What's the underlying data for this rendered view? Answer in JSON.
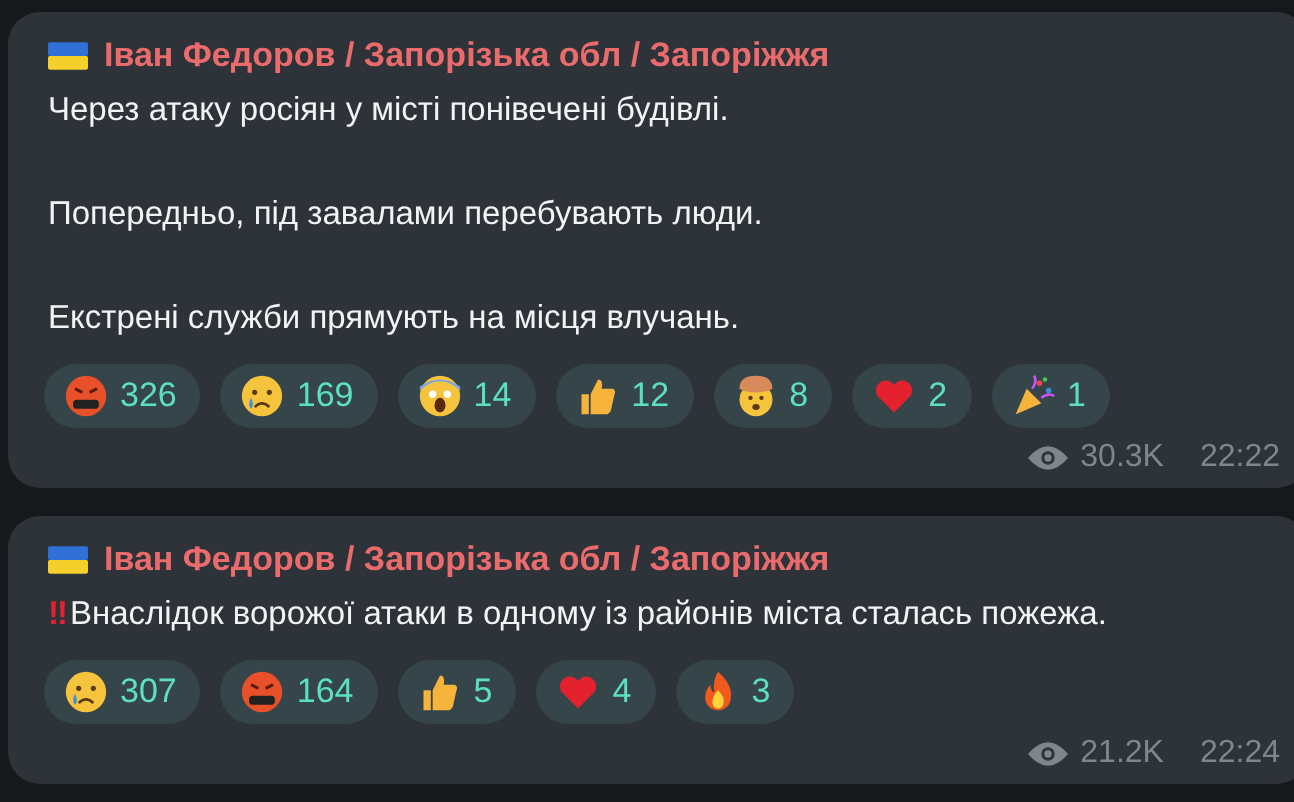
{
  "messages": [
    {
      "author": "Іван Федоров / Запорізька обл / Запоріжжя",
      "alert": false,
      "paragraphs": [
        "Через атаку росіян у місті понівечені будівлі.",
        "Попередньо, під завалами перебувають люди.",
        "Екстрені служби прямують на місця влучань."
      ],
      "reactions": [
        {
          "kind": "angry",
          "count": "326"
        },
        {
          "kind": "crying",
          "count": "169"
        },
        {
          "kind": "scream",
          "count": "14"
        },
        {
          "kind": "thumbs",
          "count": "12"
        },
        {
          "kind": "mind-blown",
          "count": "8"
        },
        {
          "kind": "heart",
          "count": "2"
        },
        {
          "kind": "party",
          "count": "1"
        }
      ],
      "views": "30.3K",
      "time": "22:22"
    },
    {
      "author": "Іван Федоров / Запорізька обл / Запоріжжя",
      "alert": true,
      "alert_mark": "‼",
      "paragraphs": [
        "Внаслідок ворожої атаки в одному із районів міста сталась пожежа."
      ],
      "reactions": [
        {
          "kind": "crying",
          "count": "307"
        },
        {
          "kind": "angry",
          "count": "164"
        },
        {
          "kind": "thumbs",
          "count": "5"
        },
        {
          "kind": "heart",
          "count": "4"
        },
        {
          "kind": "fire",
          "count": "3"
        }
      ],
      "views": "21.2K",
      "time": "22:24"
    }
  ]
}
